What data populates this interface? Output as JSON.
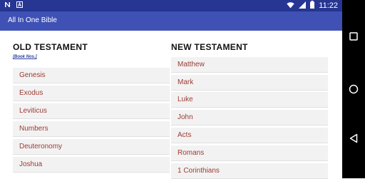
{
  "status_bar": {
    "left_icons": [
      "notification-n-icon",
      "notification-a-icon"
    ],
    "right_icons": [
      "wifi-icon",
      "signal-icon",
      "battery-icon"
    ],
    "time": "11:22",
    "colors": {
      "background": "#273593"
    }
  },
  "app_bar": {
    "title": "All In One Bible",
    "colors": {
      "background": "#3f51b5"
    }
  },
  "old_testament": {
    "heading": "OLD TESTAMENT",
    "book_nos_link": "[Book Nos.]",
    "books": [
      "Genesis",
      "Exodus",
      "Leviticus",
      "Numbers",
      "Deuteronomy",
      "Joshua"
    ]
  },
  "new_testament": {
    "heading": "NEW TESTAMENT",
    "books": [
      "Matthew",
      "Mark",
      "Luke",
      "John",
      "Acts",
      "Romans",
      "1 Corinthians"
    ]
  },
  "nav_bar": {
    "buttons": [
      "recents-square-icon",
      "home-circle-icon",
      "back-triangle-icon"
    ]
  },
  "colors": {
    "book_text": "#9b3a33",
    "book_background": "#f2f2f2",
    "link": "#2a3fa0"
  }
}
